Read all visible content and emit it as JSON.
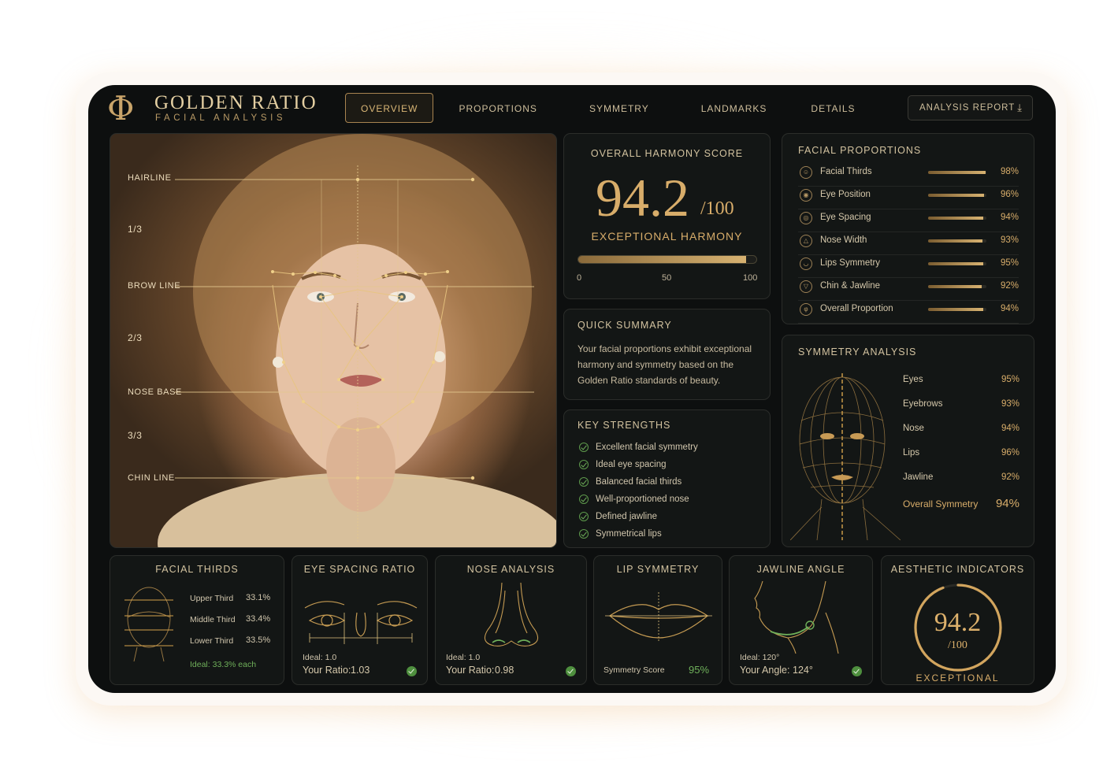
{
  "app": {
    "logo_glyph": "Φ",
    "title": "GOLDEN RATIO",
    "subtitle": "FACIAL ANALYSIS"
  },
  "nav": {
    "tabs": [
      "OVERVIEW",
      "PROPORTIONS",
      "SYMMETRY",
      "LANDMARKS",
      "DETAILS"
    ],
    "active": 0,
    "report_label": "ANALYSIS REPORT",
    "report_icon": "download-icon"
  },
  "photo": {
    "lines": [
      "HAIRLINE",
      "1/3",
      "BROW LINE",
      "2/3",
      "NOSE BASE",
      "3/3",
      "CHIN LINE"
    ]
  },
  "score": {
    "title": "OVERALL HARMONY SCORE",
    "value": "94.2",
    "denominator": "/100",
    "rating": "EXCEPTIONAL HARMONY",
    "level": 94.2,
    "ticks": [
      "0",
      "50",
      "100"
    ]
  },
  "summary": {
    "title": "QUICK SUMMARY",
    "text": "Your facial proportions exhibit exceptional harmony and symmetry based on the Golden Ratio standards of beauty."
  },
  "strengths": {
    "title": "KEY STRENGTHS",
    "items": [
      "Excellent facial symmetry",
      "Ideal eye spacing",
      "Balanced facial thirds",
      "Well-proportioned nose",
      "Defined jawline",
      "Symmetrical lips"
    ]
  },
  "proportions": {
    "title": "FACIAL PROPORTIONS",
    "items": [
      {
        "label": "Facial Thirds",
        "value": "98%",
        "level": 98,
        "icon": "face-icon"
      },
      {
        "label": "Eye Position",
        "value": "96%",
        "level": 96,
        "icon": "eye-icon"
      },
      {
        "label": "Eye Spacing",
        "value": "94%",
        "level": 94,
        "icon": "eyes-icon"
      },
      {
        "label": "Nose Width",
        "value": "93%",
        "level": 93,
        "icon": "nose-icon"
      },
      {
        "label": "Lips Symmetry",
        "value": "95%",
        "level": 95,
        "icon": "lips-icon"
      },
      {
        "label": "Chin & Jawline",
        "value": "92%",
        "level": 92,
        "icon": "chin-icon"
      },
      {
        "label": "Overall Proportion",
        "value": "94%",
        "level": 94,
        "icon": "phi-icon"
      }
    ]
  },
  "symmetry": {
    "title": "SYMMETRY ANALYSIS",
    "items": [
      {
        "label": "Eyes",
        "value": "95%"
      },
      {
        "label": "Eyebrows",
        "value": "93%"
      },
      {
        "label": "Nose",
        "value": "94%"
      },
      {
        "label": "Lips",
        "value": "96%"
      },
      {
        "label": "Jawline",
        "value": "92%"
      }
    ],
    "overall_label": "Overall Symmetry",
    "overall_value": "94%"
  },
  "thirds": {
    "title": "FACIAL THIRDS",
    "rows": [
      {
        "label": "Upper Third",
        "value": "33.1%"
      },
      {
        "label": "Middle Third",
        "value": "33.4%"
      },
      {
        "label": "Lower Third",
        "value": "33.5%"
      }
    ],
    "ideal": "Ideal: 33.3% each"
  },
  "eye_spacing": {
    "title": "EYE SPACING RATIO",
    "ideal": "Ideal: 1.0",
    "ratio_label": "Your Ratio:",
    "ratio": "1.03"
  },
  "nose": {
    "title": "NOSE ANALYSIS",
    "ideal": "Ideal: 1.0",
    "ratio_label": "Your Ratio:",
    "ratio": "0.98"
  },
  "lips": {
    "title": "LIP SYMMETRY",
    "score_label": "Symmetry Score",
    "score": "95%"
  },
  "jawline": {
    "title": "JAWLINE ANGLE",
    "ideal": "Ideal: 120°",
    "angle_label": "Your Angle:",
    "angle": "124°"
  },
  "aesthetic": {
    "title": "AESTHETIC INDICATORS",
    "value": "94.2",
    "denominator": "/100",
    "rating": "EXCEPTIONAL",
    "level": 94.2
  },
  "colors": {
    "gold": "#d8ad6a",
    "background": "#0d0f0f",
    "panel": "#131615",
    "success": "#4e8f3e"
  }
}
